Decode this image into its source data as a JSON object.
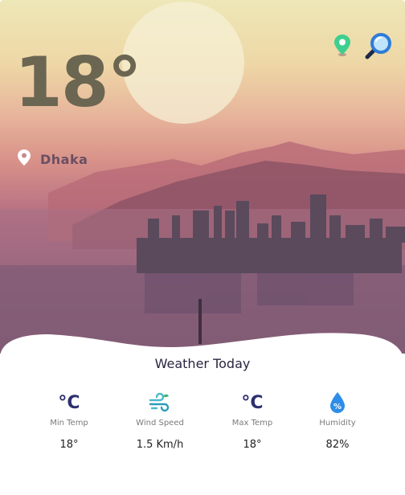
{
  "current": {
    "temperature": "18°",
    "location": "Dhaka"
  },
  "panel": {
    "title": "Weather Today",
    "stats": [
      {
        "icon": "celsius-icon",
        "glyph": "°C",
        "label": "Min Temp",
        "value": "18°"
      },
      {
        "icon": "wind-icon",
        "label": "Wind Speed",
        "value": "1.5 Km/h"
      },
      {
        "icon": "celsius-icon",
        "glyph": "°C",
        "label": "Max Temp",
        "value": "18°"
      },
      {
        "icon": "humidity-drop-icon",
        "label": "Humidity",
        "value": "82%"
      }
    ]
  },
  "colors": {
    "temperature_text": "#6b6652",
    "location_text": "#6a4f63",
    "map_pin_icon": "#3ecf8e",
    "search_icon": "#2f7cd6",
    "humidity_icon": "#2d8de8",
    "wind_icon": "#49b9c9",
    "celsius_icon": "#2c2f6e"
  }
}
